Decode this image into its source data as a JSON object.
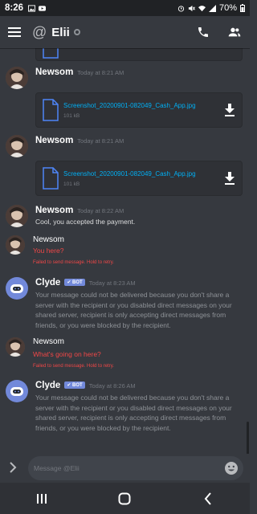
{
  "status_bar": {
    "time": "8:26",
    "battery": "70%"
  },
  "header": {
    "title": "Elii"
  },
  "messages": [
    {
      "author": "Newsom",
      "timestamp": "Today at 8:21 AM",
      "attachment": {
        "filename": "Screenshot_20200901-082049_Cash_App.jpg",
        "size": "101 kB"
      }
    },
    {
      "author": "Newsom",
      "timestamp": "Today at 8:21 AM",
      "attachment": {
        "filename": "Screenshot_20200901-082049_Cash_App.jpg",
        "size": "101 kB"
      }
    },
    {
      "author": "Newsom",
      "timestamp": "Today at 8:22 AM",
      "text": "Cool, you accepted the payment."
    },
    {
      "author": "Newsom",
      "text": "You here?",
      "failed_note": "Failed to send message. Hold to retry."
    },
    {
      "author": "Clyde",
      "badge": "BOT",
      "timestamp": "Today at 8:23 AM",
      "text": "Your message could not be delivered because you don't share a server with the recipient or you disabled direct messages on your shared server, recipient is only accepting direct messages from friends, or you were blocked by the recipient."
    },
    {
      "author": "Newsom",
      "text": "What's going on here?",
      "failed_note": "Failed to send message. Hold to retry."
    },
    {
      "author": "Clyde",
      "badge": "BOT",
      "timestamp": "Today at 8:26 AM",
      "text": "Your message could not be delivered because you don't share a server with the recipient or you disabled direct messages on your shared server, recipient is only accepting direct messages from friends, or you were blocked by the recipient."
    }
  ],
  "composer": {
    "placeholder": "Message @Elii"
  },
  "colors": {
    "background": "#36393f",
    "link": "#00aff4",
    "error": "#f04747",
    "blurple": "#7289da"
  },
  "icons": [
    "menu-icon",
    "at-icon",
    "phone-icon",
    "members-icon",
    "file-icon",
    "download-icon",
    "chevron-right-icon",
    "emoji-icon",
    "recents-icon",
    "home-icon",
    "back-icon"
  ]
}
